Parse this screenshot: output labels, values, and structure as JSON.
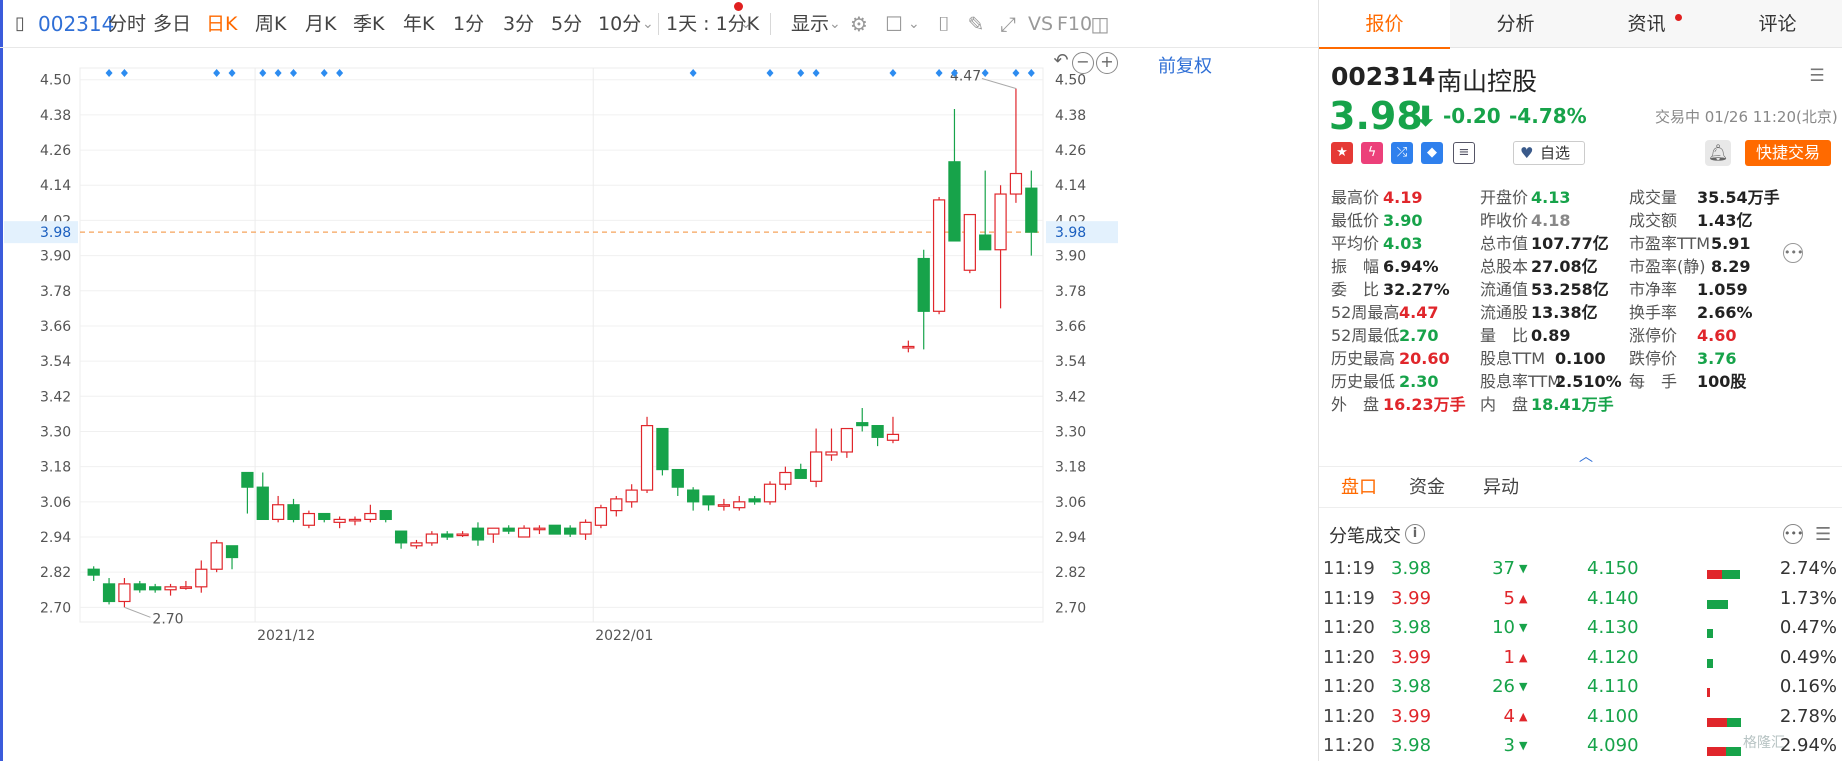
{
  "toolbar": {
    "code": "002314",
    "periods": [
      "分时",
      "多日",
      "日K",
      "周K",
      "月K",
      "季K",
      "年K",
      "1分",
      "3分",
      "5分",
      "10分"
    ],
    "active_period": "日K",
    "interval_select": "1天 : 1分K",
    "display_select": "显示",
    "vs_label": "VS",
    "f10_label": "F10"
  },
  "chart": {
    "adjust_label": "前复权",
    "current_price_label": "3.98",
    "high_marker": "4.47",
    "low_marker": "2.70",
    "date_labels": [
      "2021/12",
      "2022/01"
    ],
    "price_ticks": [
      "4.50",
      "4.38",
      "4.26",
      "4.14",
      "4.02",
      "3.90",
      "3.78",
      "3.66",
      "3.54",
      "3.42",
      "3.30",
      "3.18",
      "3.06",
      "2.94",
      "2.82",
      "2.70"
    ]
  },
  "chart_data": {
    "type": "candlestick",
    "ylim": [
      2.65,
      4.54
    ],
    "current_price": 3.98,
    "candles": [
      {
        "o": 2.83,
        "h": 2.84,
        "l": 2.79,
        "c": 2.81
      },
      {
        "o": 2.78,
        "h": 2.8,
        "l": 2.71,
        "c": 2.72
      },
      {
        "o": 2.72,
        "h": 2.8,
        "l": 2.7,
        "c": 2.78
      },
      {
        "o": 2.78,
        "h": 2.79,
        "l": 2.75,
        "c": 2.76
      },
      {
        "o": 2.77,
        "h": 2.78,
        "l": 2.75,
        "c": 2.76
      },
      {
        "o": 2.76,
        "h": 2.78,
        "l": 2.74,
        "c": 2.77
      },
      {
        "o": 2.77,
        "h": 2.79,
        "l": 2.76,
        "c": 2.77
      },
      {
        "o": 2.77,
        "h": 2.86,
        "l": 2.75,
        "c": 2.83
      },
      {
        "o": 2.83,
        "h": 2.93,
        "l": 2.82,
        "c": 2.92
      },
      {
        "o": 2.91,
        "h": 2.91,
        "l": 2.83,
        "c": 2.87
      },
      {
        "o": 3.16,
        "h": 3.16,
        "l": 3.02,
        "c": 3.11
      },
      {
        "o": 3.11,
        "h": 3.16,
        "l": 3.0,
        "c": 3.0
      },
      {
        "o": 3.0,
        "h": 3.08,
        "l": 2.99,
        "c": 3.05
      },
      {
        "o": 3.05,
        "h": 3.07,
        "l": 2.99,
        "c": 3.0
      },
      {
        "o": 2.98,
        "h": 3.03,
        "l": 2.97,
        "c": 3.02
      },
      {
        "o": 3.02,
        "h": 3.02,
        "l": 2.99,
        "c": 3.0
      },
      {
        "o": 2.99,
        "h": 3.01,
        "l": 2.97,
        "c": 3.0
      },
      {
        "o": 3.0,
        "h": 3.01,
        "l": 2.98,
        "c": 3.0
      },
      {
        "o": 3.0,
        "h": 3.05,
        "l": 2.99,
        "c": 3.02
      },
      {
        "o": 3.03,
        "h": 3.03,
        "l": 2.99,
        "c": 3.0
      },
      {
        "o": 2.96,
        "h": 2.96,
        "l": 2.9,
        "c": 2.92
      },
      {
        "o": 2.91,
        "h": 2.93,
        "l": 2.9,
        "c": 2.92
      },
      {
        "o": 2.92,
        "h": 2.96,
        "l": 2.91,
        "c": 2.95
      },
      {
        "o": 2.95,
        "h": 2.96,
        "l": 2.93,
        "c": 2.94
      },
      {
        "o": 2.95,
        "h": 2.96,
        "l": 2.94,
        "c": 2.95
      },
      {
        "o": 2.97,
        "h": 2.99,
        "l": 2.91,
        "c": 2.93
      },
      {
        "o": 2.95,
        "h": 2.97,
        "l": 2.92,
        "c": 2.97
      },
      {
        "o": 2.97,
        "h": 2.98,
        "l": 2.95,
        "c": 2.96
      },
      {
        "o": 2.94,
        "h": 2.98,
        "l": 2.94,
        "c": 2.97
      },
      {
        "o": 2.97,
        "h": 2.98,
        "l": 2.95,
        "c": 2.97
      },
      {
        "o": 2.98,
        "h": 2.98,
        "l": 2.95,
        "c": 2.95
      },
      {
        "o": 2.97,
        "h": 2.98,
        "l": 2.94,
        "c": 2.95
      },
      {
        "o": 2.95,
        "h": 3.0,
        "l": 2.93,
        "c": 2.99
      },
      {
        "o": 2.98,
        "h": 3.05,
        "l": 2.97,
        "c": 3.04
      },
      {
        "o": 3.03,
        "h": 3.08,
        "l": 3.01,
        "c": 3.07
      },
      {
        "o": 3.06,
        "h": 3.12,
        "l": 3.04,
        "c": 3.1
      },
      {
        "o": 3.1,
        "h": 3.35,
        "l": 3.09,
        "c": 3.32
      },
      {
        "o": 3.31,
        "h": 3.31,
        "l": 3.15,
        "c": 3.17
      },
      {
        "o": 3.17,
        "h": 3.17,
        "l": 3.08,
        "c": 3.11
      },
      {
        "o": 3.1,
        "h": 3.11,
        "l": 3.03,
        "c": 3.06
      },
      {
        "o": 3.08,
        "h": 3.08,
        "l": 3.03,
        "c": 3.05
      },
      {
        "o": 3.05,
        "h": 3.07,
        "l": 3.03,
        "c": 3.05
      },
      {
        "o": 3.04,
        "h": 3.08,
        "l": 3.03,
        "c": 3.06
      },
      {
        "o": 3.07,
        "h": 3.08,
        "l": 3.05,
        "c": 3.06
      },
      {
        "o": 3.06,
        "h": 3.13,
        "l": 3.05,
        "c": 3.12
      },
      {
        "o": 3.12,
        "h": 3.18,
        "l": 3.1,
        "c": 3.16
      },
      {
        "o": 3.17,
        "h": 3.19,
        "l": 3.14,
        "c": 3.14
      },
      {
        "o": 3.13,
        "h": 3.31,
        "l": 3.11,
        "c": 3.23
      },
      {
        "o": 3.22,
        "h": 3.31,
        "l": 3.2,
        "c": 3.23
      },
      {
        "o": 3.23,
        "h": 3.31,
        "l": 3.21,
        "c": 3.31
      },
      {
        "o": 3.33,
        "h": 3.38,
        "l": 3.3,
        "c": 3.32
      },
      {
        "o": 3.32,
        "h": 3.32,
        "l": 3.25,
        "c": 3.28
      },
      {
        "o": 3.27,
        "h": 3.35,
        "l": 3.26,
        "c": 3.29
      },
      {
        "o": 3.59,
        "h": 3.61,
        "l": 3.57,
        "c": 3.59
      },
      {
        "o": 3.89,
        "h": 3.92,
        "l": 3.58,
        "c": 3.71
      },
      {
        "o": 3.71,
        "h": 4.1,
        "l": 3.7,
        "c": 4.09
      },
      {
        "o": 4.22,
        "h": 4.4,
        "l": 3.95,
        "c": 3.95
      },
      {
        "o": 3.85,
        "h": 4.04,
        "l": 3.84,
        "c": 4.04
      },
      {
        "o": 3.97,
        "h": 4.19,
        "l": 3.92,
        "c": 3.92
      },
      {
        "o": 3.92,
        "h": 4.14,
        "l": 3.72,
        "c": 4.11
      },
      {
        "o": 4.11,
        "h": 4.47,
        "l": 4.08,
        "c": 4.18
      },
      {
        "o": 4.13,
        "h": 4.19,
        "l": 3.9,
        "c": 3.98
      }
    ],
    "top_markers": [
      1,
      2,
      8,
      9,
      11,
      12,
      13,
      15,
      16,
      39,
      44,
      46,
      47,
      52,
      55,
      56,
      58,
      60,
      61
    ]
  },
  "right_tabs": {
    "quote": "报价",
    "analysis": "分析",
    "news": "资讯",
    "comments": "评论"
  },
  "stock": {
    "code": "002314",
    "name": "南山控股",
    "price": "3.98",
    "change": "-0.20",
    "change_pct": "-4.78%",
    "status": "交易中 01/26 11:20(北京)",
    "fav_label": "自选",
    "trade_label": "快捷交易"
  },
  "quote_rows": [
    [
      {
        "l": "最高价",
        "v": "4.19",
        "c": "up"
      },
      {
        "l": "开盘价",
        "v": "4.13",
        "c": "dn"
      },
      {
        "l": "成交量",
        "v": "35.54万手",
        "c": ""
      }
    ],
    [
      {
        "l": "最低价",
        "v": "3.90",
        "c": "dn"
      },
      {
        "l": "昨收价",
        "v": "4.18",
        "c": "gr"
      },
      {
        "l": "成交额",
        "v": "1.43亿",
        "c": ""
      }
    ],
    [
      {
        "l": "平均价",
        "v": "4.03",
        "c": "dn"
      },
      {
        "l": "总市值",
        "v": "107.77亿",
        "c": ""
      },
      {
        "l": "市盈率TTM",
        "v": "5.91",
        "c": ""
      }
    ],
    [
      {
        "l": "振　幅",
        "v": "6.94%",
        "c": ""
      },
      {
        "l": "总股本",
        "v": "27.08亿",
        "c": ""
      },
      {
        "l": "市盈率(静)",
        "v": "8.29",
        "c": ""
      }
    ],
    [
      {
        "l": "委　比",
        "v": "32.27%",
        "c": ""
      },
      {
        "l": "流通值",
        "v": "53.258亿",
        "c": ""
      },
      {
        "l": "市净率",
        "v": "1.059",
        "c": ""
      }
    ],
    [
      {
        "l": "52周最高",
        "v": "4.47",
        "c": "up"
      },
      {
        "l": "流通股",
        "v": "13.38亿",
        "c": ""
      },
      {
        "l": "换手率",
        "v": "2.66%",
        "c": ""
      }
    ],
    [
      {
        "l": "52周最低",
        "v": "2.70",
        "c": "dn"
      },
      {
        "l": "量　比",
        "v": "0.89",
        "c": ""
      },
      {
        "l": "涨停价",
        "v": "4.60",
        "c": "up"
      }
    ],
    [
      {
        "l": "历史最高",
        "v": "20.60",
        "c": "up"
      },
      {
        "l": "股息TTM",
        "v": "0.100",
        "c": ""
      },
      {
        "l": "跌停价",
        "v": "3.76",
        "c": "dn"
      }
    ],
    [
      {
        "l": "历史最低",
        "v": "2.30",
        "c": "dn"
      },
      {
        "l": "股息率TTM",
        "v": "2.510%",
        "c": ""
      },
      {
        "l": "每　手",
        "v": "100股",
        "c": ""
      }
    ],
    [
      {
        "l": "外　盘",
        "v": "16.23万手",
        "c": "up"
      },
      {
        "l": "内　盘",
        "v": "18.41万手",
        "c": "dn"
      },
      {
        "l": "",
        "v": "",
        "c": ""
      }
    ]
  ],
  "sub_tabs": {
    "panel": "盘口",
    "fund": "资金",
    "anomaly": "异动"
  },
  "trades": {
    "title": "分笔成交",
    "rows": [
      {
        "time": "11:19",
        "price": "3.98",
        "pc": "dn",
        "vol": "37",
        "dir": "dn",
        "level": "4.150",
        "pct": "2.74%",
        "r": 0.45,
        "g": 0.55
      },
      {
        "time": "11:19",
        "price": "3.99",
        "pc": "up",
        "vol": "5",
        "dir": "up",
        "level": "4.140",
        "pct": "1.73%",
        "r": 0.0,
        "g": 1.0
      },
      {
        "time": "11:20",
        "price": "3.98",
        "pc": "dn",
        "vol": "10",
        "dir": "dn",
        "level": "4.130",
        "pct": "0.47%",
        "r": 0.0,
        "g": 1.0
      },
      {
        "time": "11:20",
        "price": "3.99",
        "pc": "up",
        "vol": "1",
        "dir": "up",
        "level": "4.120",
        "pct": "0.49%",
        "r": 0.0,
        "g": 1.0
      },
      {
        "time": "11:20",
        "price": "3.98",
        "pc": "dn",
        "vol": "26",
        "dir": "dn",
        "level": "4.110",
        "pct": "0.16%",
        "r": 1.0,
        "g": 0.0
      },
      {
        "time": "11:20",
        "price": "3.99",
        "pc": "up",
        "vol": "4",
        "dir": "up",
        "level": "4.100",
        "pct": "2.78%",
        "r": 0.6,
        "g": 0.4
      },
      {
        "time": "11:20",
        "price": "3.98",
        "pc": "dn",
        "vol": "3",
        "dir": "dn",
        "level": "4.090",
        "pct": "2.94%",
        "r": 0.55,
        "g": 0.45
      }
    ]
  },
  "watermark": "格隆汇",
  "colors": {
    "up": "#e0262b",
    "down": "#17a34a",
    "accent": "#ff6a00",
    "link": "#2f6fd6",
    "marker": "#2d8cf0"
  }
}
